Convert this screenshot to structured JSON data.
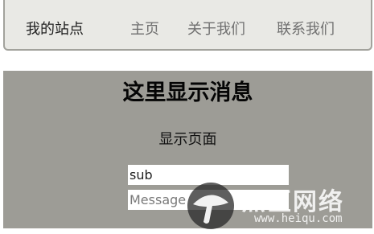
{
  "navbar": {
    "brand": "我的站点",
    "links": [
      "主页",
      "关于我们",
      "联系我们"
    ]
  },
  "main": {
    "message": "这里显示消息",
    "page_label": "显示页面",
    "fields": [
      {
        "value": "sub",
        "placeholder": ""
      },
      {
        "value": "",
        "placeholder": "Message"
      }
    ]
  },
  "watermark": {
    "title": "黑区网络",
    "url": "www.heiqu.com"
  },
  "colors": {
    "navbar_bg": "#e9e9e5",
    "panel_bg": "#9d9c96"
  }
}
